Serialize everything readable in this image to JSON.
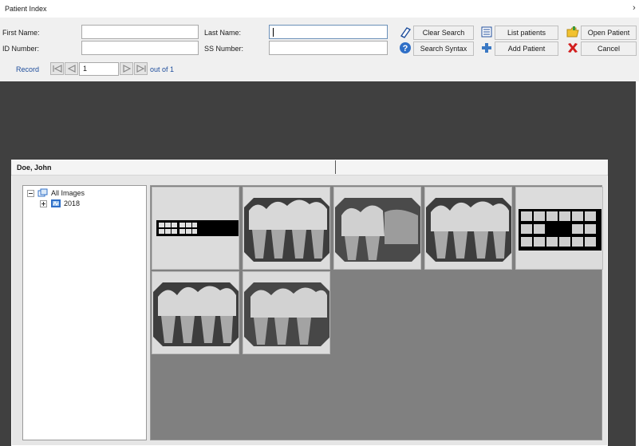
{
  "window": {
    "title": "Patient Index",
    "close_glyph": "›"
  },
  "search": {
    "first_name_label": "First Name:",
    "last_name_label": "Last Name:",
    "id_number_label": "ID Number:",
    "ss_number_label": "SS Number:",
    "first_name_value": "",
    "last_name_value": "",
    "id_number_value": "",
    "ss_number_value": ""
  },
  "buttons": {
    "clear_search": "Clear Search",
    "search_syntax": "Search Syntax",
    "list_patients": "List patients",
    "add_patient": "Add Patient",
    "open_patient": "Open Patient",
    "cancel": "Cancel"
  },
  "icons": {
    "clear_search": "eraser-icon",
    "search_syntax": "help-icon",
    "list_patients": "list-icon",
    "add_patient": "plus-icon",
    "open_patient": "folder-open-icon",
    "cancel": "close-icon"
  },
  "record_nav": {
    "label": "Record",
    "current": "1",
    "out_of_text": "out of 1"
  },
  "patient": {
    "name": "Doe, John"
  },
  "tree": {
    "root_label": "All Images",
    "children": [
      {
        "label": "2018"
      }
    ]
  },
  "gallery": {
    "thumbnails": [
      {
        "kind": "fmx-strip"
      },
      {
        "kind": "bitewing"
      },
      {
        "kind": "periapical"
      },
      {
        "kind": "bitewing"
      },
      {
        "kind": "fmx-full"
      },
      {
        "kind": "bitewing"
      },
      {
        "kind": "periapical"
      }
    ]
  },
  "colors": {
    "accent_link": "#1f4e9c",
    "dark_background": "#404040",
    "gallery_background": "#808080",
    "cancel_red": "#d21f1f",
    "add_blue": "#3a78c4"
  }
}
